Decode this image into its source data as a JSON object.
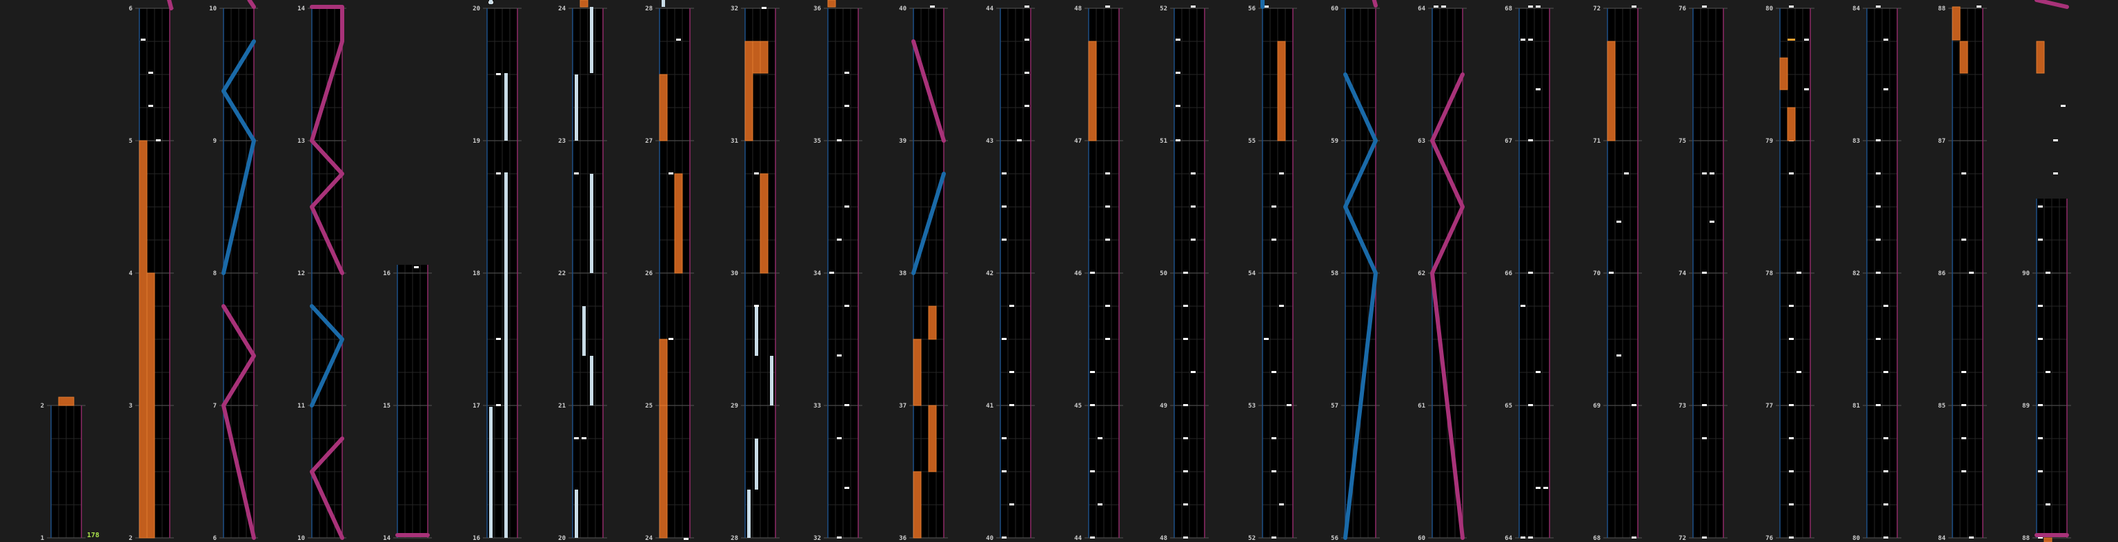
{
  "editor": {
    "view": "chart-preview-columns",
    "combo_label": "178",
    "colors": {
      "background": "#1c1c1c",
      "lane_background": "#000000",
      "grid": "#262626",
      "measure_line": "#4a4a4a",
      "lane_border_left": "#1d4f86",
      "lane_border_right": "#8e2a67",
      "tap_note": "#ffffff",
      "long_note": "#c9dce7",
      "hold_note": "#c25e1d",
      "hold_note_edge": "#e07a2e",
      "fx_note": "#f0a030",
      "laser_left": "#1a6aa8",
      "laser_right": "#a83279",
      "measure_number": "#cccccc",
      "combo": "#a8e04a"
    }
  },
  "chart_data": {
    "type": "note-chart",
    "notes_visible": "tap, long, hold, laser-left, laser-right, fx",
    "measure_numbers": {
      "column_1": [
        1,
        2
      ],
      "column_2": [
        2,
        3,
        4,
        5,
        6
      ],
      "column_3": [
        6,
        7,
        8,
        9,
        10
      ],
      "column_4": [
        10,
        11,
        12,
        13,
        14
      ],
      "column_5": [
        14,
        15,
        16
      ],
      "column_6": [
        16,
        17,
        18,
        19,
        20
      ],
      "column_7": [
        20,
        21,
        22,
        23,
        24
      ],
      "column_8": [
        24,
        25,
        26,
        27,
        28
      ],
      "column_9": [
        28,
        29,
        30,
        31,
        32
      ],
      "column_10": [
        32,
        33,
        34,
        35,
        36
      ],
      "column_11": [
        36,
        37,
        38,
        39,
        40
      ],
      "column_12": [
        40,
        41,
        42,
        43,
        44
      ],
      "column_13": [
        44,
        45,
        46,
        47,
        48
      ],
      "column_14": [
        48,
        49,
        50,
        51,
        52
      ],
      "column_15": [
        52,
        53,
        54,
        55,
        56
      ],
      "column_16": [
        56,
        57,
        58,
        59,
        60
      ],
      "column_17": [
        60,
        61,
        62,
        63,
        64
      ],
      "column_18": [
        64,
        65,
        66,
        67,
        68
      ],
      "column_19": [
        68,
        69,
        70,
        71,
        72
      ],
      "column_20": [
        72,
        73,
        74,
        75,
        76
      ],
      "column_21": [
        76,
        77,
        78,
        79,
        80
      ],
      "column_22": [
        80,
        81,
        82,
        83,
        84
      ],
      "column_23": [
        84,
        85,
        86,
        87,
        88
      ],
      "column_24": [
        88,
        89,
        90
      ]
    }
  }
}
